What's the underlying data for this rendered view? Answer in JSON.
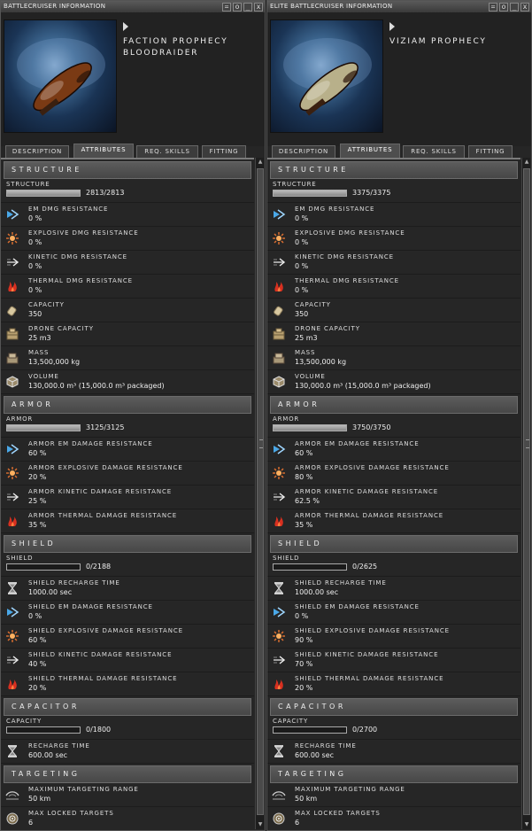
{
  "windows": [
    {
      "title": "BATTLECRUISER INFORMATION",
      "ship_name_line1": "FACTION PROPHECY",
      "ship_name_line2": "BLOODRAIDER",
      "hull_color": "#7a3a14",
      "tabs": [
        "DESCRIPTION",
        "ATTRIBUTES",
        "REQ. SKILLS",
        "FITTING"
      ],
      "active_tab": 1,
      "sections": {
        "structure": {
          "title": "STRUCTURE",
          "bar": {
            "label": "STRUCTURE",
            "value": "2813/2813",
            "fill": 1.0
          },
          "rows": [
            {
              "icon": "em-resist-icon",
              "label": "EM DMG RESISTANCE",
              "value": "0 %"
            },
            {
              "icon": "explosive-resist-icon",
              "label": "EXPLOSIVE DMG RESISTANCE",
              "value": "0 %"
            },
            {
              "icon": "kinetic-resist-icon",
              "label": "KINETIC DMG RESISTANCE",
              "value": "0 %"
            },
            {
              "icon": "thermal-resist-icon",
              "label": "THERMAL DMG RESISTANCE",
              "value": "0 %"
            },
            {
              "icon": "capacity-icon",
              "label": "CAPACITY",
              "value": "350"
            },
            {
              "icon": "drone-capacity-icon",
              "label": "DRONE CAPACITY",
              "value": "25 m3"
            },
            {
              "icon": "mass-icon",
              "label": "MASS",
              "value": "13,500,000 kg"
            },
            {
              "icon": "volume-icon",
              "label": "VOLUME",
              "value": "130,000.0 m³ (15,000.0 m³ packaged)"
            }
          ]
        },
        "armor": {
          "title": "ARMOR",
          "bar": {
            "label": "ARMOR",
            "value": "3125/3125",
            "fill": 1.0
          },
          "rows": [
            {
              "icon": "em-resist-icon",
              "label": "ARMOR EM DAMAGE RESISTANCE",
              "value": "60 %"
            },
            {
              "icon": "explosive-resist-icon",
              "label": "ARMOR EXPLOSIVE DAMAGE RESISTANCE",
              "value": "20 %"
            },
            {
              "icon": "kinetic-resist-icon",
              "label": "ARMOR KINETIC DAMAGE RESISTANCE",
              "value": "25 %"
            },
            {
              "icon": "thermal-resist-icon",
              "label": "ARMOR THERMAL DAMAGE RESISTANCE",
              "value": "35 %"
            }
          ]
        },
        "shield": {
          "title": "SHIELD",
          "bar": {
            "label": "SHIELD",
            "value": "0/2188",
            "fill": 0
          },
          "rows": [
            {
              "icon": "hourglass-icon",
              "label": "SHIELD RECHARGE TIME",
              "value": "1000.00 sec"
            },
            {
              "icon": "em-resist-icon",
              "label": "SHIELD EM DAMAGE RESISTANCE",
              "value": "0 %"
            },
            {
              "icon": "explosive-resist-icon",
              "label": "SHIELD EXPLOSIVE DAMAGE RESISTANCE",
              "value": "60 %"
            },
            {
              "icon": "kinetic-resist-icon",
              "label": "SHIELD KINETIC DAMAGE RESISTANCE",
              "value": "40 %"
            },
            {
              "icon": "thermal-resist-icon",
              "label": "SHIELD THERMAL DAMAGE RESISTANCE",
              "value": "20 %"
            }
          ]
        },
        "capacitor": {
          "title": "CAPACITOR",
          "bar": {
            "label": "CAPACITY",
            "value": "0/1800",
            "fill": 0
          },
          "rows": [
            {
              "icon": "hourglass-icon",
              "label": "RECHARGE TIME",
              "value": "600.00 sec"
            }
          ]
        },
        "targeting": {
          "title": "TARGETING",
          "rows": [
            {
              "icon": "targeting-range-icon",
              "label": "MAXIMUM TARGETING RANGE",
              "value": "50 km"
            },
            {
              "icon": "locked-targets-icon",
              "label": "MAX LOCKED TARGETS",
              "value": "6"
            }
          ]
        }
      }
    },
    {
      "title": "ELITE BATTLECRUISER INFORMATION",
      "ship_name_line1": "VIZIAM PROPHECY",
      "ship_name_line2": "",
      "hull_color": "#b8b08a",
      "tabs": [
        "DESCRIPTION",
        "ATTRIBUTES",
        "REQ. SKILLS",
        "FITTING"
      ],
      "active_tab": 1,
      "sections": {
        "structure": {
          "title": "STRUCTURE",
          "bar": {
            "label": "STRUCTURE",
            "value": "3375/3375",
            "fill": 1.0
          },
          "rows": [
            {
              "icon": "em-resist-icon",
              "label": "EM DMG RESISTANCE",
              "value": "0 %"
            },
            {
              "icon": "explosive-resist-icon",
              "label": "EXPLOSIVE DMG RESISTANCE",
              "value": "0 %"
            },
            {
              "icon": "kinetic-resist-icon",
              "label": "KINETIC DMG RESISTANCE",
              "value": "0 %"
            },
            {
              "icon": "thermal-resist-icon",
              "label": "THERMAL DMG RESISTANCE",
              "value": "0 %"
            },
            {
              "icon": "capacity-icon",
              "label": "CAPACITY",
              "value": "350"
            },
            {
              "icon": "drone-capacity-icon",
              "label": "DRONE CAPACITY",
              "value": "25 m3"
            },
            {
              "icon": "mass-icon",
              "label": "MASS",
              "value": "13,500,000 kg"
            },
            {
              "icon": "volume-icon",
              "label": "VOLUME",
              "value": "130,000.0 m³ (15,000.0 m³ packaged)"
            }
          ]
        },
        "armor": {
          "title": "ARMOR",
          "bar": {
            "label": "ARMOR",
            "value": "3750/3750",
            "fill": 1.0
          },
          "rows": [
            {
              "icon": "em-resist-icon",
              "label": "ARMOR EM DAMAGE RESISTANCE",
              "value": "60 %"
            },
            {
              "icon": "explosive-resist-icon",
              "label": "ARMOR EXPLOSIVE DAMAGE RESISTANCE",
              "value": "80 %"
            },
            {
              "icon": "kinetic-resist-icon",
              "label": "ARMOR KINETIC DAMAGE RESISTANCE",
              "value": "62.5 %"
            },
            {
              "icon": "thermal-resist-icon",
              "label": "ARMOR THERMAL DAMAGE RESISTANCE",
              "value": "35 %"
            }
          ]
        },
        "shield": {
          "title": "SHIELD",
          "bar": {
            "label": "SHIELD",
            "value": "0/2625",
            "fill": 0
          },
          "rows": [
            {
              "icon": "hourglass-icon",
              "label": "SHIELD RECHARGE TIME",
              "value": "1000.00 sec"
            },
            {
              "icon": "em-resist-icon",
              "label": "SHIELD EM DAMAGE RESISTANCE",
              "value": "0 %"
            },
            {
              "icon": "explosive-resist-icon",
              "label": "SHIELD EXPLOSIVE DAMAGE RESISTANCE",
              "value": "90 %"
            },
            {
              "icon": "kinetic-resist-icon",
              "label": "SHIELD KINETIC DAMAGE RESISTANCE",
              "value": "70 %"
            },
            {
              "icon": "thermal-resist-icon",
              "label": "SHIELD THERMAL DAMAGE RESISTANCE",
              "value": "20 %"
            }
          ]
        },
        "capacitor": {
          "title": "CAPACITOR",
          "bar": {
            "label": "CAPACITY",
            "value": "0/2700",
            "fill": 0
          },
          "rows": [
            {
              "icon": "hourglass-icon",
              "label": "RECHARGE TIME",
              "value": "600.00 sec"
            }
          ]
        },
        "targeting": {
          "title": "TARGETING",
          "rows": [
            {
              "icon": "targeting-range-icon",
              "label": "MAXIMUM TARGETING RANGE",
              "value": "50 km"
            },
            {
              "icon": "locked-targets-icon",
              "label": "MAX LOCKED TARGETS",
              "value": "6"
            }
          ]
        }
      }
    }
  ],
  "window_buttons": [
    "=",
    "o",
    "_",
    "x"
  ]
}
